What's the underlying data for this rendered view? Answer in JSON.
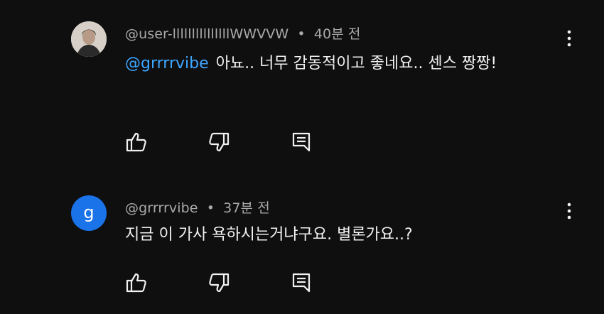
{
  "comments": [
    {
      "author": "@user-lllllllllllllllWWVVW",
      "separator": "•",
      "time": "40분 전",
      "avatar_icon": "profile-photo",
      "mention": "@grrrrvibe",
      "text": "아뇨.. 너무 감동적이고 좋네요.. 센스 짱짱!"
    },
    {
      "author": "@grrrrvibe",
      "separator": "•",
      "time": "37분 전",
      "avatar_letter": "g",
      "avatar_color": "#1a73e8",
      "text": "지금 이 가사 욕하시는거냐구요. 별론가요..?"
    }
  ],
  "icons": {
    "like": "thumbs-up-icon",
    "dislike": "thumbs-down-icon",
    "reply": "reply-icon",
    "more": "more-vert-icon"
  },
  "colors": {
    "background": "#0f0f0f",
    "mention": "#3ea6ff",
    "meta": "#aaaaaa",
    "text": "#f1f1f1"
  }
}
